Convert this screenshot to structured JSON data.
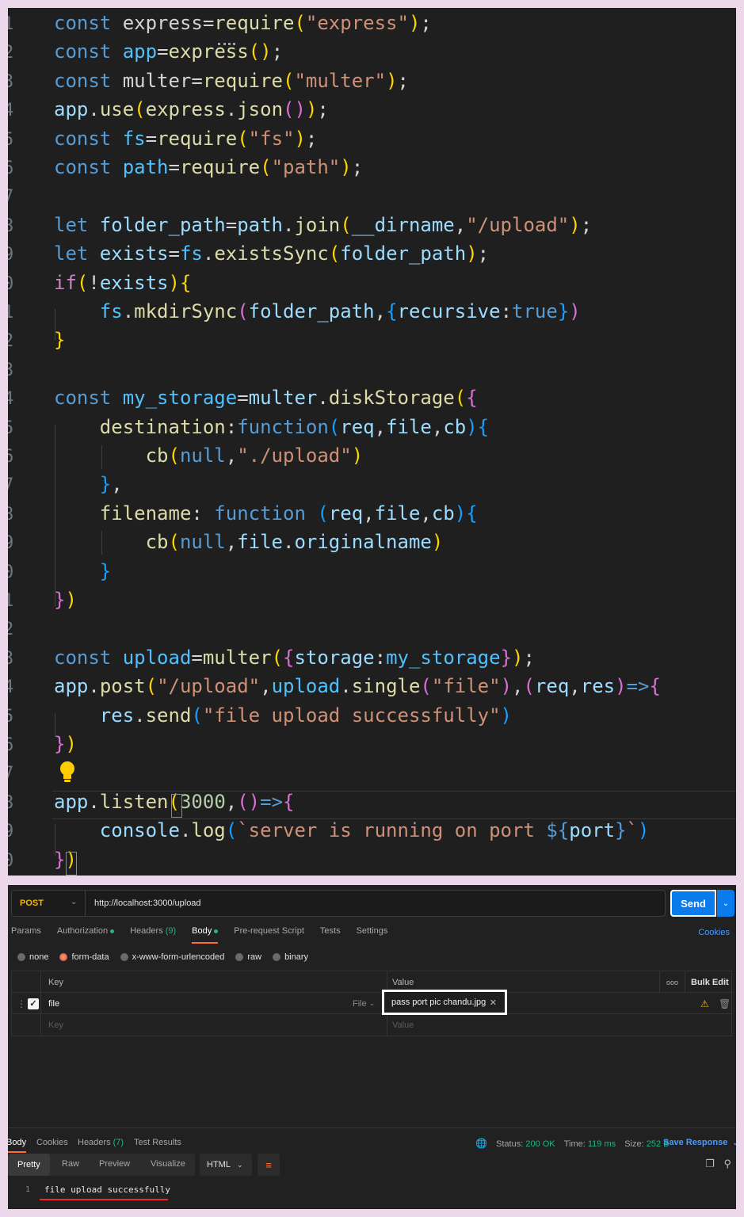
{
  "editor": {
    "gutter": [
      "1",
      "2",
      "3",
      "4",
      "5",
      "6",
      "7",
      "8",
      "9",
      "0",
      "1",
      "2",
      "3",
      "4",
      "5",
      "6",
      "7",
      "8",
      "9",
      "0",
      "1",
      "2",
      "3",
      "4",
      "5",
      "6",
      "7",
      "8",
      "9",
      "0"
    ],
    "lines": [
      [
        [
          "kw",
          "const "
        ],
        [
          "p",
          "express="
        ],
        [
          "fn",
          "require"
        ],
        [
          "br1",
          "("
        ],
        [
          "str",
          "\"express\""
        ],
        [
          "br1",
          ")"
        ],
        [
          "p",
          ";"
        ]
      ],
      [
        [
          "kw",
          "const "
        ],
        [
          "const",
          "app"
        ],
        [
          "p",
          "="
        ],
        [
          "fn",
          "express"
        ],
        [
          "br1",
          "()"
        ],
        [
          "p",
          ";"
        ]
      ],
      [
        [
          "kw",
          "const "
        ],
        [
          "p",
          "multer="
        ],
        [
          "fn",
          "require"
        ],
        [
          "br1",
          "("
        ],
        [
          "str",
          "\"multer\""
        ],
        [
          "br1",
          ")"
        ],
        [
          "p",
          ";"
        ]
      ],
      [
        [
          "var",
          "app"
        ],
        [
          "p",
          "."
        ],
        [
          "fn",
          "use"
        ],
        [
          "br1",
          "("
        ],
        [
          "fn",
          "express"
        ],
        [
          "p",
          "."
        ],
        [
          "fn",
          "json"
        ],
        [
          "br2",
          "()"
        ],
        [
          "br1",
          ")"
        ],
        [
          "p",
          ";"
        ]
      ],
      [
        [
          "kw",
          "const "
        ],
        [
          "const",
          "fs"
        ],
        [
          "p",
          "="
        ],
        [
          "fn",
          "require"
        ],
        [
          "br1",
          "("
        ],
        [
          "str",
          "\"fs\""
        ],
        [
          "br1",
          ")"
        ],
        [
          "p",
          ";"
        ]
      ],
      [
        [
          "kw",
          "const "
        ],
        [
          "const",
          "path"
        ],
        [
          "p",
          "="
        ],
        [
          "fn",
          "require"
        ],
        [
          "br1",
          "("
        ],
        [
          "str",
          "\"path\""
        ],
        [
          "br1",
          ")"
        ],
        [
          "p",
          ";"
        ]
      ],
      [],
      [
        [
          "kw",
          "let "
        ],
        [
          "var",
          "folder_path"
        ],
        [
          "p",
          "="
        ],
        [
          "var",
          "path"
        ],
        [
          "p",
          "."
        ],
        [
          "fn",
          "join"
        ],
        [
          "br1",
          "("
        ],
        [
          "var",
          "__dirname"
        ],
        [
          "p",
          ","
        ],
        [
          "str",
          "\"/upload\""
        ],
        [
          "br1",
          ")"
        ],
        [
          "p",
          ";"
        ]
      ],
      [
        [
          "kw",
          "let "
        ],
        [
          "var",
          "exists"
        ],
        [
          "p",
          "="
        ],
        [
          "const",
          "fs"
        ],
        [
          "p",
          "."
        ],
        [
          "fn",
          "existsSync"
        ],
        [
          "br1",
          "("
        ],
        [
          "var",
          "folder_path"
        ],
        [
          "br1",
          ")"
        ],
        [
          "p",
          ";"
        ]
      ],
      [
        [
          "ctl",
          "if"
        ],
        [
          "br1",
          "("
        ],
        [
          "p",
          "!"
        ],
        [
          "var",
          "exists"
        ],
        [
          "br1",
          ")"
        ],
        [
          "br1",
          "{"
        ]
      ],
      [
        [
          "p",
          "    "
        ],
        [
          "const",
          "fs"
        ],
        [
          "p",
          "."
        ],
        [
          "fn",
          "mkdirSync"
        ],
        [
          "br2",
          "("
        ],
        [
          "var",
          "folder_path"
        ],
        [
          "p",
          ","
        ],
        [
          "br3",
          "{"
        ],
        [
          "var",
          "recursive"
        ],
        [
          "p",
          ":"
        ],
        [
          "kw",
          "true"
        ],
        [
          "br3",
          "}"
        ],
        [
          "br2",
          ")"
        ]
      ],
      [
        [
          "br1",
          "}"
        ]
      ],
      [],
      [
        [
          "kw",
          "const "
        ],
        [
          "const",
          "my_storage"
        ],
        [
          "p",
          "="
        ],
        [
          "var",
          "multer"
        ],
        [
          "p",
          "."
        ],
        [
          "fn",
          "diskStorage"
        ],
        [
          "br1",
          "("
        ],
        [
          "br2",
          "{"
        ]
      ],
      [
        [
          "p",
          "    "
        ],
        [
          "fn",
          "destination"
        ],
        [
          "p",
          ":"
        ],
        [
          "kw",
          "function"
        ],
        [
          "br3",
          "("
        ],
        [
          "var",
          "req"
        ],
        [
          "p",
          ","
        ],
        [
          "var",
          "file"
        ],
        [
          "p",
          ","
        ],
        [
          "var",
          "cb"
        ],
        [
          "br3",
          ")"
        ],
        [
          "br3",
          "{"
        ]
      ],
      [
        [
          "p",
          "        "
        ],
        [
          "fn",
          "cb"
        ],
        [
          "br1",
          "("
        ],
        [
          "kw",
          "null"
        ],
        [
          "p",
          ","
        ],
        [
          "str",
          "\"./upload\""
        ],
        [
          "br1",
          ")"
        ]
      ],
      [
        [
          "p",
          "    "
        ],
        [
          "br3",
          "}"
        ],
        [
          "p",
          ","
        ]
      ],
      [
        [
          "p",
          "    "
        ],
        [
          "fn",
          "filename"
        ],
        [
          "p",
          ": "
        ],
        [
          "kw",
          "function "
        ],
        [
          "br3",
          "("
        ],
        [
          "var",
          "req"
        ],
        [
          "p",
          ","
        ],
        [
          "var",
          "file"
        ],
        [
          "p",
          ","
        ],
        [
          "var",
          "cb"
        ],
        [
          "br3",
          ")"
        ],
        [
          "br3",
          "{"
        ]
      ],
      [
        [
          "p",
          "        "
        ],
        [
          "fn",
          "cb"
        ],
        [
          "br1",
          "("
        ],
        [
          "kw",
          "null"
        ],
        [
          "p",
          ","
        ],
        [
          "var",
          "file"
        ],
        [
          "p",
          "."
        ],
        [
          "var",
          "originalname"
        ],
        [
          "br1",
          ")"
        ]
      ],
      [
        [
          "p",
          "    "
        ],
        [
          "br3",
          "}"
        ]
      ],
      [
        [
          "br2",
          "}"
        ],
        [
          "br1",
          ")"
        ]
      ],
      [],
      [
        [
          "kw",
          "const "
        ],
        [
          "const",
          "upload"
        ],
        [
          "p",
          "="
        ],
        [
          "fn",
          "multer"
        ],
        [
          "br1",
          "("
        ],
        [
          "br2",
          "{"
        ],
        [
          "var",
          "storage"
        ],
        [
          "p",
          ":"
        ],
        [
          "const",
          "my_storage"
        ],
        [
          "br2",
          "}"
        ],
        [
          "br1",
          ")"
        ],
        [
          "p",
          ";"
        ]
      ],
      [
        [
          "var",
          "app"
        ],
        [
          "p",
          "."
        ],
        [
          "fn",
          "post"
        ],
        [
          "br1",
          "("
        ],
        [
          "str",
          "\"/upload\""
        ],
        [
          "p",
          ","
        ],
        [
          "const",
          "upload"
        ],
        [
          "p",
          "."
        ],
        [
          "fn",
          "single"
        ],
        [
          "br2",
          "("
        ],
        [
          "str",
          "\"file\""
        ],
        [
          "br2",
          ")"
        ],
        [
          "p",
          ","
        ],
        [
          "br2",
          "("
        ],
        [
          "var",
          "req"
        ],
        [
          "p",
          ","
        ],
        [
          "var",
          "res"
        ],
        [
          "br2",
          ")"
        ],
        [
          "kw",
          "=>"
        ],
        [
          "br2",
          "{"
        ]
      ],
      [
        [
          "p",
          "    "
        ],
        [
          "var",
          "res"
        ],
        [
          "p",
          "."
        ],
        [
          "fn",
          "send"
        ],
        [
          "br3",
          "("
        ],
        [
          "str",
          "\"file upload successfully\""
        ],
        [
          "br3",
          ")"
        ]
      ],
      [
        [
          "br2",
          "}"
        ],
        [
          "br1",
          ")"
        ]
      ],
      [],
      [
        [
          "var",
          "app"
        ],
        [
          "p",
          "."
        ],
        [
          "fn",
          "listen"
        ],
        [
          "br1",
          "("
        ],
        [
          "num",
          "3000"
        ],
        [
          "p",
          ","
        ],
        [
          "br2",
          "()"
        ],
        [
          "kw",
          "=>"
        ],
        [
          "br2",
          "{"
        ]
      ],
      [
        [
          "p",
          "    "
        ],
        [
          "var",
          "console"
        ],
        [
          "p",
          "."
        ],
        [
          "fn",
          "log"
        ],
        [
          "br3",
          "("
        ],
        [
          "str",
          "`server is running on port "
        ],
        [
          "kw",
          "${"
        ],
        [
          "var",
          "port"
        ],
        [
          "kw",
          "}"
        ],
        [
          "str",
          "`"
        ],
        [
          "br3",
          ")"
        ]
      ],
      [
        [
          "br2",
          "}"
        ],
        [
          "br1",
          ")"
        ]
      ]
    ]
  },
  "postman": {
    "method": "POST",
    "url": "http://localhost:3000/upload",
    "send_label": "Send",
    "tabs": [
      {
        "label": "Params",
        "suffix": ""
      },
      {
        "label": "Authorization",
        "suffix": "dot"
      },
      {
        "label": "Headers",
        "suffix": "(9)"
      },
      {
        "label": "Body",
        "suffix": "dot",
        "active": true
      },
      {
        "label": "Pre-request Script",
        "suffix": ""
      },
      {
        "label": "Tests",
        "suffix": ""
      },
      {
        "label": "Settings",
        "suffix": ""
      }
    ],
    "cookies_label": "Cookies",
    "body_types": [
      "none",
      "form-data",
      "x-www-form-urlencoded",
      "raw",
      "binary"
    ],
    "selected_body_type": "form-data",
    "kv_header": {
      "key": "Key",
      "value": "Value",
      "bulk_edit": "Bulk Edit",
      "more": "ooo"
    },
    "kv_row": {
      "key": "file",
      "type": "File",
      "value": "pass port pic chandu.jpg"
    },
    "kv_placeholder": {
      "key": "Key",
      "value": "Value"
    },
    "response_tabs": [
      {
        "label": "Body",
        "active": true
      },
      {
        "label": "Cookies"
      },
      {
        "label": "Headers",
        "count": "(7)"
      },
      {
        "label": "Test Results"
      }
    ],
    "status": {
      "status_label": "Status:",
      "status_value": "200 OK",
      "time_label": "Time:",
      "time_value": "119 ms",
      "size_label": "Size:",
      "size_value": "252 B"
    },
    "save_response": "Save Response",
    "format_buttons": [
      "Pretty",
      "Raw",
      "Preview",
      "Visualize"
    ],
    "language": "HTML",
    "response_line_number": "1",
    "response_text": "file upload successfully"
  }
}
